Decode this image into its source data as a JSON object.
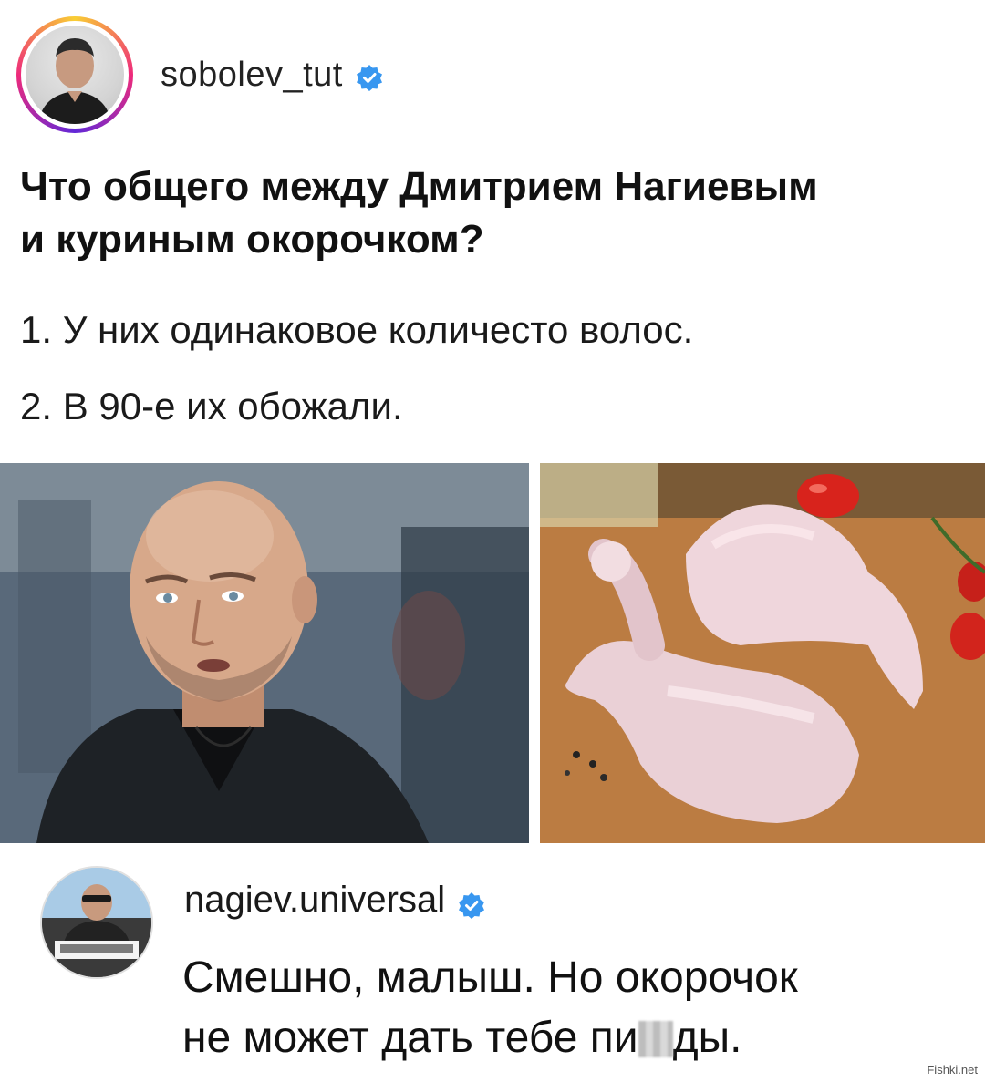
{
  "post": {
    "username": "sobolev_tut",
    "title_line1": "Что общего между Дмитрием Нагиевым",
    "title_line2": "и куриным окорочком?",
    "point1": "1. У них одинаковое количесто волос.",
    "point2": "2. В 90-е их обожали."
  },
  "comment": {
    "username": "nagiev.universal",
    "line1": "Смешно, малыш. Но окорочок",
    "line2_before": "не может дать тебе пи",
    "line2_after": "ды."
  },
  "watermark": "Fishki.net",
  "colors": {
    "verified": "#3897f0",
    "text": "#111111"
  },
  "icons": [
    "verified-badge-icon"
  ]
}
